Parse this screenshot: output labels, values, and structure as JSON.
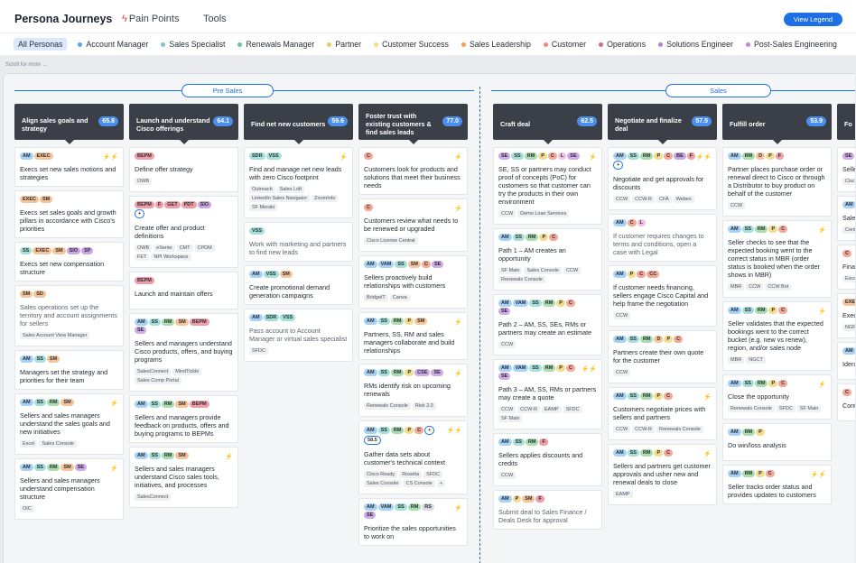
{
  "app": {
    "title": "Persona Journeys",
    "tabs": [
      "Pain Points",
      "Tools"
    ],
    "view_legend_label": "View Legend"
  },
  "filters": [
    {
      "label": "All Personas",
      "active": true,
      "color": ""
    },
    {
      "label": "Account Manager",
      "color": "#5aa6e8"
    },
    {
      "label": "Sales Specialist",
      "color": "#7fc4d6"
    },
    {
      "label": "Renewals Manager",
      "color": "#6cc39a"
    },
    {
      "label": "Partner",
      "color": "#f0c86a"
    },
    {
      "label": "Customer Success",
      "color": "#f5dd86"
    },
    {
      "label": "Sales Leadership",
      "color": "#f0a25a"
    },
    {
      "label": "Customer",
      "color": "#ef8c76"
    },
    {
      "label": "Operations",
      "color": "#d36d86"
    },
    {
      "label": "Solutions Engineer",
      "color": "#b57fcf"
    },
    {
      "label": "Post-Sales Engineering",
      "color": "#c084d8"
    }
  ],
  "scroll_hint": "Scroll for more →",
  "tag_colors": {
    "AM": "#a8d2f5",
    "SS": "#a5dfd8",
    "RM": "#a9dcae",
    "P": "#f3db90",
    "C": "#f4a898",
    "L": "#eec0e3",
    "SE": "#cfa9e8",
    "EXEC": "#f6c49a",
    "SM": "#f6c49a",
    "SIO": "#c9a6e3",
    "SP": "#c9a6e3",
    "SD": "#f6c49a",
    "BEPM": "#f09ca8",
    "F": "#f09ca8",
    "GET": "#f09ca8",
    "PDT": "#f09ca8",
    "SDR": "#a5dfd8",
    "VSS": "#a5dfd8",
    "VAM": "#a8d2f5",
    "CSE": "#cfa9e8",
    "CC": "#f4a898",
    "BE": "#c9a6e3",
    "D": "#f6c49a",
    "58.5": "#ffffff",
    "+": "#ffffff"
  },
  "phases": [
    {
      "label": "Pre Sales"
    },
    {
      "label": "Sales"
    }
  ],
  "columns": [
    {
      "title": "Align sales goals and strategy",
      "score": "65.8",
      "cards": [
        {
          "tags": [
            "AM",
            "EXEC"
          ],
          "bolts": "⚡⚡",
          "text": "Execs set new sales motions and strategies",
          "muted": false,
          "tools": []
        },
        {
          "tags": [
            "EXEC",
            "SM"
          ],
          "bolts": "",
          "text": "Execs set sales goals and growth pillars in accordance with Cisco's priorities",
          "muted": false,
          "tools": []
        },
        {
          "tags": [
            "SS",
            "EXEC",
            "SM",
            "SIO",
            "SP"
          ],
          "bolts": "",
          "text": "Execs set new compensation structure",
          "muted": false,
          "tools": []
        },
        {
          "tags": [
            "SM",
            "SD"
          ],
          "bolts": "",
          "text": "Sales operations set up the territory and account assignments for sellers",
          "muted": true,
          "tools": [
            "Sales Account View Manager"
          ]
        },
        {
          "tags": [
            "AM",
            "SS",
            "SM"
          ],
          "bolts": "",
          "text": "Managers set the strategy and priorities for their team",
          "muted": false,
          "tools": []
        },
        {
          "tags": [
            "AM",
            "SS",
            "RM",
            "SM"
          ],
          "bolts": "⚡",
          "text": "Sellers and sales managers understand the sales goals and new initiatives",
          "muted": false,
          "tools": [
            "Excel",
            "Sales Console"
          ]
        },
        {
          "tags": [
            "AM",
            "SS",
            "RM",
            "SM",
            "SE"
          ],
          "bolts": "⚡",
          "text": "Sellers and sales managers understand compensation structure",
          "muted": false,
          "tools": [
            "OIC"
          ]
        }
      ]
    },
    {
      "title": "Launch and understand Cisco offerings",
      "score": "64.1",
      "cards": [
        {
          "tags": [
            "BEPM"
          ],
          "bolts": "",
          "text": "Define offer strategy",
          "muted": false,
          "tools": [
            "OWB"
          ]
        },
        {
          "tags": [
            "BEPM",
            "F",
            "GET",
            "PDT",
            "SIO",
            "+"
          ],
          "bolts": "",
          "text": "Create offer and product definitions",
          "muted": false,
          "tools": [
            "OWB",
            "eSente",
            "CMT",
            "CPDM",
            "FET",
            "NPI Workspace"
          ]
        },
        {
          "tags": [
            "BEPM"
          ],
          "bolts": "",
          "text": "Launch and maintain offers",
          "muted": false,
          "tools": []
        },
        {
          "tags": [
            "AM",
            "SS",
            "RM",
            "SM",
            "BEPM",
            "SE"
          ],
          "bolts": "",
          "text": "Sellers and managers understand Cisco products, offers, and buying programs",
          "muted": false,
          "tools": [
            "SalesConnect",
            "MindTickle",
            "Sales Comp Portal"
          ]
        },
        {
          "tags": [
            "AM",
            "SS",
            "RM",
            "SM",
            "BEPM"
          ],
          "bolts": "",
          "text": "Sellers and managers provide feedback on products, offers and buying programs to BEPMs",
          "muted": false,
          "tools": []
        },
        {
          "tags": [
            "AM",
            "SS",
            "RM",
            "SM"
          ],
          "bolts": "⚡",
          "text": "Sellers and sales managers understand Cisco sales tools, initiatives, and processes",
          "muted": false,
          "tools": [
            "SalesConnect"
          ]
        }
      ]
    },
    {
      "title": "Find net new customers",
      "score": "59.6",
      "cards": [
        {
          "tags": [
            "SDR",
            "VSS"
          ],
          "bolts": "⚡",
          "text": "Find and manage net new leads with zero Cisco footprint",
          "muted": false,
          "tools": [
            "Outreach",
            "Sales Loft",
            "LinkedIn Sales Navigator",
            "ZoomInfo",
            "SF Meraki"
          ]
        },
        {
          "tags": [
            "VSS"
          ],
          "bolts": "",
          "text": "Work with marketing and partners to find new leads",
          "muted": true,
          "tools": []
        },
        {
          "tags": [
            "AM",
            "VSS",
            "SM"
          ],
          "bolts": "",
          "text": "Create promotional demand generation campaigns",
          "muted": false,
          "tools": []
        },
        {
          "tags": [
            "AM",
            "SDR",
            "VSS"
          ],
          "bolts": "",
          "text": "Pass account to Account Manager or virtual sales specialist",
          "muted": true,
          "tools": [
            "SFDC"
          ]
        }
      ]
    },
    {
      "title": "Foster trust with existing customers & find sales leads",
      "score": "77.0",
      "cards": [
        {
          "tags": [
            "C"
          ],
          "bolts": "⚡",
          "text": "Customers look for products and solutions that meet their business needs",
          "muted": false,
          "tools": []
        },
        {
          "tags": [
            "C"
          ],
          "bolts": "⚡",
          "text": "Customers review what needs to be renewed or upgraded",
          "muted": false,
          "tools": [
            "Cisco License Central"
          ]
        },
        {
          "tags": [
            "AM",
            "VAM",
            "SS",
            "SM",
            "C",
            "SE"
          ],
          "bolts": "",
          "text": "Sellers proactively build relationships with customers",
          "muted": false,
          "tools": [
            "BridgeIT",
            "Canva"
          ]
        },
        {
          "tags": [
            "AM",
            "SS",
            "RM",
            "P",
            "SM"
          ],
          "bolts": "⚡",
          "text": "Partners, SS, RM and sales managers collaborate and build relationships",
          "muted": false,
          "tools": []
        },
        {
          "tags": [
            "AM",
            "SS",
            "RM",
            "P",
            "CSE",
            "SE"
          ],
          "bolts": "⚡",
          "text": "RMs identify risk on upcoming renewals",
          "muted": false,
          "tools": [
            "Renewals Console",
            "Risk 2.0"
          ]
        },
        {
          "tags": [
            "AM",
            "SS",
            "RM",
            "P",
            "C",
            "+",
            "58.5"
          ],
          "bolts": "⚡⚡",
          "text": "Gather data sets about customer's technical context",
          "muted": false,
          "tools": [
            "Cisco Ready",
            "Rosetta",
            "SFDC",
            "Sales Console",
            "CS Console",
            "+"
          ]
        },
        {
          "tags": [
            "AM",
            "VAM",
            "SS",
            "RM",
            "RS",
            "SE"
          ],
          "bolts": "⚡",
          "text": "Prioritize the sales opportunities to work on",
          "muted": false,
          "tools": []
        }
      ]
    },
    {
      "title": "Craft deal",
      "score": "62.5",
      "cards": [
        {
          "tags": [
            "SE",
            "SS",
            "RM",
            "P",
            "C",
            "L",
            "SE"
          ],
          "bolts": "⚡",
          "text": "SE, SS or partners may conduct proof of concepts (PoC) for customers so that customer can try the products in their own environment",
          "muted": false,
          "tools": [
            "CCW",
            "Demo Loan Services"
          ]
        },
        {
          "tags": [
            "AM",
            "SS",
            "RM",
            "P",
            "C"
          ],
          "bolts": "",
          "text": "Path 1 – AM creates an opportunity",
          "muted": false,
          "tools": [
            "SF Main",
            "Sales Console",
            "CCW",
            "Renewals Console"
          ]
        },
        {
          "tags": [
            "AM",
            "VAM",
            "SS",
            "RM",
            "P",
            "C",
            "SE"
          ],
          "bolts": "",
          "text": "Path 2 – AM, SS, SEs, RMs or partners may create an estimate",
          "muted": false,
          "tools": [
            "CCW"
          ]
        },
        {
          "tags": [
            "AM",
            "VAM",
            "SS",
            "RM",
            "P",
            "C",
            "SE"
          ],
          "bolts": "⚡⚡",
          "text": "Path 3 – AM, SS, RMs or partners may create a quote",
          "muted": false,
          "tools": [
            "CCW",
            "CCW-R",
            "EAMP",
            "SFDC",
            "SF Main"
          ]
        },
        {
          "tags": [
            "AM",
            "SS",
            "RM",
            "F"
          ],
          "bolts": "",
          "text": "Sellers applies discounts and credits",
          "muted": false,
          "tools": [
            "CCW"
          ]
        },
        {
          "tags": [
            "AM",
            "P",
            "SM",
            "F"
          ],
          "bolts": "",
          "text": "Submit deal to Sales Finance / Deals Desk for approval",
          "muted": true,
          "tools": []
        }
      ]
    },
    {
      "title": "Negotiate and finalize deal",
      "score": "57.5",
      "cards": [
        {
          "tags": [
            "AM",
            "SS",
            "RM",
            "P",
            "C",
            "BE",
            "F",
            "+"
          ],
          "bolts": "⚡⚡",
          "text": "Negotiate and get approvals for discounts",
          "muted": false,
          "tools": [
            "CCW",
            "CCW-R",
            "CFA",
            "Webex"
          ]
        },
        {
          "tags": [
            "AM",
            "C",
            "L"
          ],
          "bolts": "",
          "text": "If customer requires changes to terms and conditions, open a case with Legal",
          "muted": true,
          "tools": []
        },
        {
          "tags": [
            "AM",
            "P",
            "C",
            "CC"
          ],
          "bolts": "",
          "text": "If customer needs financing, sellers engage Cisco Capital and help frame the negotiation",
          "muted": false,
          "tools": [
            "CCW"
          ]
        },
        {
          "tags": [
            "AM",
            "SS",
            "RM",
            "D",
            "P",
            "C"
          ],
          "bolts": "",
          "text": "Partners create their own quote for the customer",
          "muted": false,
          "tools": [
            "CCW"
          ]
        },
        {
          "tags": [
            "AM",
            "SS",
            "RM",
            "P",
            "C"
          ],
          "bolts": "⚡",
          "text": "Customers negotiate prices with sellers and partners",
          "muted": false,
          "tools": [
            "CCW",
            "CCW-R",
            "Renewals Console"
          ]
        },
        {
          "tags": [
            "AM",
            "SS",
            "RM",
            "P",
            "C"
          ],
          "bolts": "⚡",
          "text": "Sellers and partners get customer approvals and usher new and renewal deals to close",
          "muted": false,
          "tools": [
            "EAMP"
          ]
        }
      ]
    },
    {
      "title": "Fulfill order",
      "score": "53.9",
      "cards": [
        {
          "tags": [
            "AM",
            "RM",
            "D",
            "P",
            "F"
          ],
          "bolts": "",
          "text": "Partner places purchase order or renewal direct to Cisco or through a Distributor to buy product on behalf of the customer",
          "muted": false,
          "tools": [
            "CCW"
          ]
        },
        {
          "tags": [
            "AM",
            "SS",
            "RM",
            "P",
            "C"
          ],
          "bolts": "⚡",
          "text": "Seller checks to see that the expected booking went to the correct status in MBR (order status is booked when the order shows in MBR)",
          "muted": false,
          "tools": [
            "MBR",
            "CCW",
            "CCW Bot"
          ]
        },
        {
          "tags": [
            "AM",
            "SS",
            "RM",
            "P",
            "C"
          ],
          "bolts": "⚡",
          "text": "Seller validates that the expected bookings went to the correct bucket (e.g. new vs renew), region, and/or sales node",
          "muted": false,
          "tools": [
            "MBR",
            "NGCT"
          ]
        },
        {
          "tags": [
            "AM",
            "SS",
            "RM",
            "P",
            "C"
          ],
          "bolts": "⚡",
          "text": "Close the opportunity",
          "muted": false,
          "tools": [
            "Renewals Console",
            "SFDC",
            "SF Main"
          ]
        },
        {
          "tags": [
            "AM",
            "RM",
            "P"
          ],
          "bolts": "",
          "text": "Do win/loss analysis",
          "muted": false,
          "tools": []
        },
        {
          "tags": [
            "AM",
            "RM",
            "P",
            "C"
          ],
          "bolts": "⚡⚡",
          "text": "Seller tracks order status and provides updates to customers",
          "muted": false,
          "tools": []
        }
      ]
    },
    {
      "title": "Fo",
      "score": "",
      "cards": [
        {
          "tags": [
            "SE"
          ],
          "bolts": "",
          "text": "Selle",
          "muted": false,
          "tools": [
            "Cisc",
            "NGF"
          ]
        },
        {
          "tags": [
            "AM"
          ],
          "bolts": "",
          "text": "Sale adju",
          "muted": false,
          "tools": [
            "Cent",
            "NGF"
          ]
        },
        {
          "tags": [
            "C"
          ],
          "bolts": "",
          "text": "Finar and",
          "muted": false,
          "tools": [
            "Exca"
          ]
        },
        {
          "tags": [
            "EXEC"
          ],
          "bolts": "",
          "text": "Exec weel",
          "muted": false,
          "tools": [
            "NGF"
          ]
        },
        {
          "tags": [
            "AM"
          ],
          "bolts": "",
          "text": "Ident subs",
          "muted": false,
          "tools": []
        },
        {
          "tags": [
            "C"
          ],
          "bolts": "",
          "text": "Cont usag",
          "muted": false,
          "tools": []
        }
      ]
    }
  ]
}
